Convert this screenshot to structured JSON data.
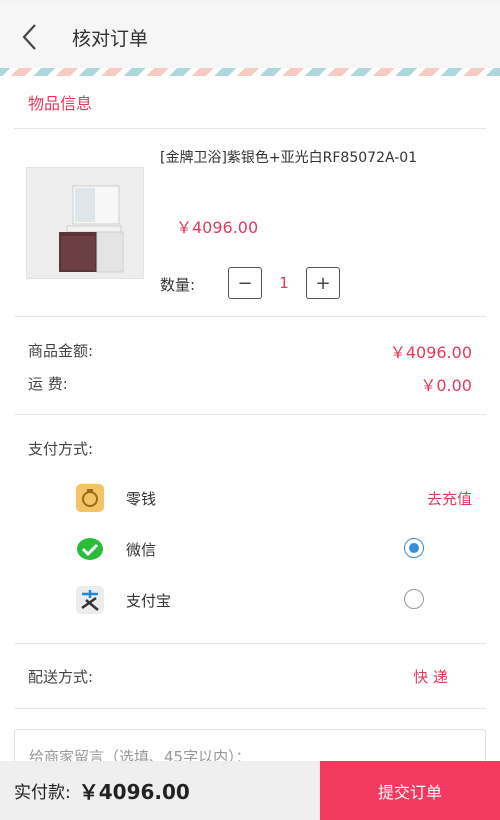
{
  "header": {
    "title": "核对订单",
    "back_icon": "back-chevron-icon"
  },
  "product_section": {
    "title": "物品信息",
    "product": {
      "name": "[金牌卫浴]紫银色+亚光白RF85072A-01",
      "price": "￥4096.00",
      "image_icon": "bathroom-cabinet-image",
      "quantity_label": "数量:",
      "quantity": "1",
      "minus_symbol": "−",
      "plus_symbol": "+"
    }
  },
  "summary": {
    "goods_amount_label": "商品金额:",
    "goods_amount_value": "￥4096.00",
    "shipping_label": "运 费:",
    "shipping_value": "￥0.00"
  },
  "payment": {
    "title": "支付方式:",
    "methods": [
      {
        "label": "零钱",
        "icon": "wallet-icon",
        "action": "去充值"
      },
      {
        "label": "微信",
        "icon": "wechat-icon",
        "selected": true
      },
      {
        "label": "支付宝",
        "icon": "alipay-icon",
        "selected": false
      }
    ]
  },
  "delivery": {
    "label": "配送方式:",
    "value": "快 递"
  },
  "message": {
    "placeholder": "给商家留言（选填、45字以内）："
  },
  "footer": {
    "total_label": "实付款:",
    "total_value": "￥4096.00",
    "submit_label": "提交订单"
  },
  "colors": {
    "accent": "#e43a5c",
    "submit_bg": "#f2395e",
    "radio_selected": "#3b8ed6"
  }
}
